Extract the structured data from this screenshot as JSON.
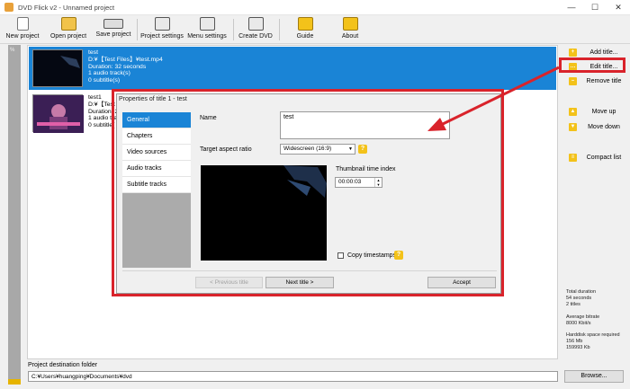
{
  "window": {
    "title": "DVD Flick v2 - Unnamed project",
    "controls": {
      "minimize": "—",
      "maximize": "☐",
      "close": "✕"
    }
  },
  "toolbar": {
    "buttons": [
      {
        "label": "New project",
        "icon": "new-project-icon"
      },
      {
        "label": "Open project",
        "icon": "open-folder-icon"
      },
      {
        "label": "Save project",
        "icon": "save-icon"
      },
      {
        "label": "Project settings",
        "icon": "project-settings-icon"
      },
      {
        "label": "Menu settings",
        "icon": "menu-settings-icon"
      },
      {
        "label": "Create DVD",
        "icon": "create-dvd-icon"
      },
      {
        "label": "Guide",
        "icon": "guide-icon"
      },
      {
        "label": "About",
        "icon": "about-icon"
      }
    ]
  },
  "left_strip": {
    "text": "%"
  },
  "titles": [
    {
      "name": "test",
      "path": "D:¥【Test Files】¥test.mp4",
      "duration": "Duration: 32 seconds",
      "audio": "1 audio track(s)",
      "subtitles": "0 subtitle(s)"
    },
    {
      "name": "test1",
      "path": "D:¥【Test Files",
      "duration": "Duration: 2",
      "audio": "1 audio tra",
      "subtitles": "0 subtitle("
    }
  ],
  "right_panel": {
    "add_title": "Add title...",
    "edit_title": "Edit title...",
    "remove_title": "Remove title",
    "move_up": "Move up",
    "move_down": "Move down",
    "compact_list": "Compact list",
    "stats": {
      "total_duration_label": "Total duration",
      "total_duration_value": "54 seconds",
      "titles_count": "2 titles",
      "avg_bitrate_label": "Average bitrate",
      "avg_bitrate_value": "8000 Kbit/s",
      "hdd_label": "Harddisk space required",
      "hdd_mb": "156 Mb",
      "hdd_kb": "159993 Kb"
    }
  },
  "destination": {
    "label": "Project destination folder",
    "path": "C:¥Users¥huangping¥Documents¥dvd",
    "browse": "Browse..."
  },
  "dialog": {
    "title": "Properties of title 1 - test",
    "tabs": [
      "General",
      "Chapters",
      "Video sources",
      "Audio tracks",
      "Subtitle tracks"
    ],
    "name_label": "Name",
    "name_value": "test",
    "aspect_label": "Target aspect ratio",
    "aspect_value": "Widescreen (16:9)",
    "thumb_label": "Thumbnail time index",
    "thumb_value": "00:00:03",
    "copy_timestamps": "Copy timestamps",
    "help": "?",
    "prev_btn": "< Previous title",
    "next_btn": "Next title >",
    "accept_btn": "Accept"
  },
  "colors": {
    "selection": "#1a84d6",
    "annotation_red": "#d9232b",
    "icon_yellow": "#f3c21a"
  }
}
